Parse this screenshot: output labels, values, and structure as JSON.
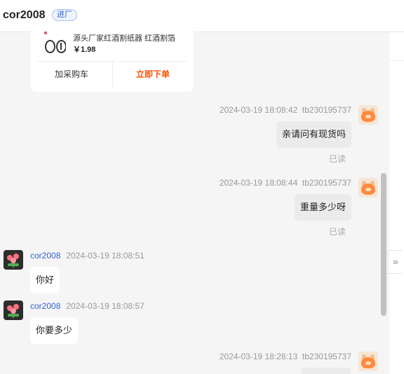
{
  "header": {
    "title": "cor2008",
    "badge": "进厂"
  },
  "product": {
    "name": "源头厂家红酒割纸器 红酒割箔",
    "price": "￥1.98",
    "cart_label": "加采购车",
    "order_label": "立即下单"
  },
  "messages": [
    {
      "time": "2024-03-19 18:08:42",
      "sender": "tb230195737",
      "text": "亲请问有现货吗",
      "status": "已读"
    },
    {
      "time": "2024-03-19 18:08:44",
      "sender": "tb230195737",
      "text": "重量多少呀",
      "status": "已读"
    },
    {
      "time": "2024-03-19 18:08:51",
      "sender": "cor2008",
      "text": "你好"
    },
    {
      "time": "2024-03-19 18:08:57",
      "sender": "cor2008",
      "text": "你要多少"
    },
    {
      "time": "2024-03-19 18:28:13",
      "sender": "tb230195737",
      "text": ""
    }
  ],
  "colors": {
    "accent": "#ff5000",
    "nick": "#3a5fcd",
    "badge": "#2a62d4"
  },
  "icons": {
    "collapse": "double-chevron-right-icon"
  }
}
